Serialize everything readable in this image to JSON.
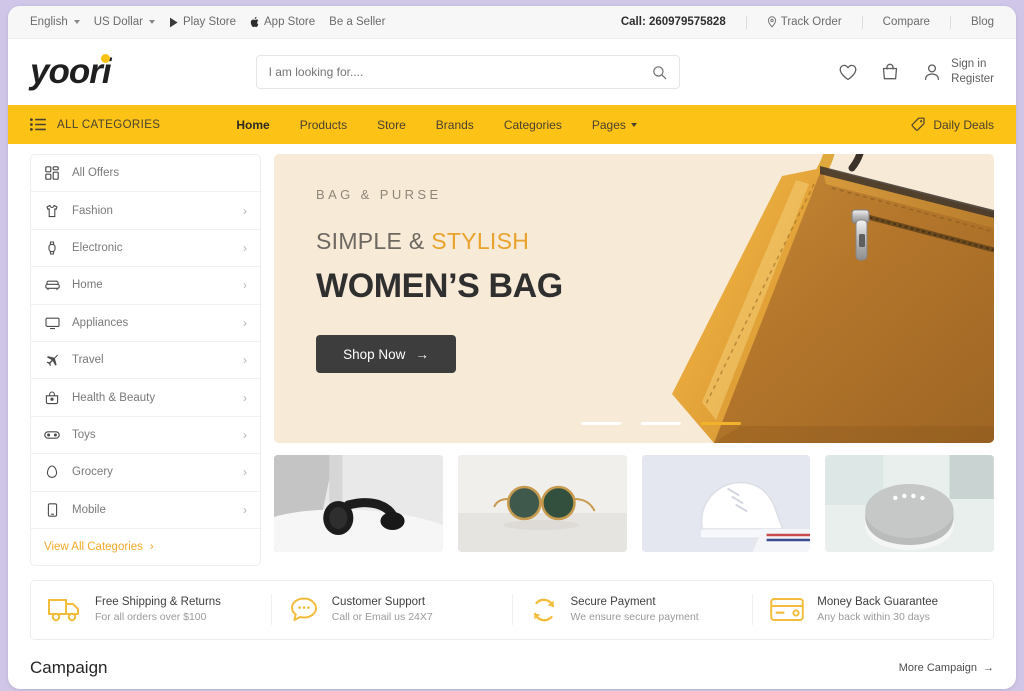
{
  "topbar": {
    "language": "English",
    "currency": "US Dollar",
    "play_store": "Play Store",
    "app_store": "App Store",
    "be_a_seller": "Be a Seller",
    "call": "Call: 260979575828",
    "track_order": "Track Order",
    "compare": "Compare",
    "blog": "Blog"
  },
  "header": {
    "logo": "yoori",
    "search_placeholder": "I am looking for....",
    "search_value": "",
    "sign_in": "Sign in",
    "register": "Register"
  },
  "nav": {
    "all_categories": "ALL CATEGORIES",
    "links": [
      {
        "label": "Home",
        "active": true
      },
      {
        "label": "Products",
        "active": false
      },
      {
        "label": "Store",
        "active": false
      },
      {
        "label": "Brands",
        "active": false
      },
      {
        "label": "Categories",
        "active": false
      },
      {
        "label": "Pages",
        "active": false,
        "has_dropdown": true
      }
    ],
    "daily_deals": "Daily Deals"
  },
  "sidebar": {
    "items": [
      {
        "label": "All Offers",
        "icon": "grid-icon",
        "chevron": false
      },
      {
        "label": "Fashion",
        "icon": "tshirt-icon",
        "chevron": true
      },
      {
        "label": "Electronic",
        "icon": "watch-icon",
        "chevron": true
      },
      {
        "label": "Home",
        "icon": "sofa-icon",
        "chevron": true
      },
      {
        "label": "Appliances",
        "icon": "monitor-icon",
        "chevron": true
      },
      {
        "label": "Travel",
        "icon": "plane-icon",
        "chevron": true
      },
      {
        "label": "Health & Beauty",
        "icon": "bag-beauty-icon",
        "chevron": true
      },
      {
        "label": "Toys",
        "icon": "mask-icon",
        "chevron": true
      },
      {
        "label": "Grocery",
        "icon": "egg-icon",
        "chevron": true
      },
      {
        "label": "Mobile",
        "icon": "phone-icon",
        "chevron": true
      }
    ],
    "view_all": "View All Categories"
  },
  "hero": {
    "kicker": "BAG & PURSE",
    "subtitle_plain": "SIMPLE & ",
    "subtitle_highlight": "STYLISH",
    "title": "WOMEN’S BAG",
    "cta": "Shop Now",
    "slides": 3,
    "active_slide": 3
  },
  "thumbnails": [
    {
      "alt": "headphones-on-bed"
    },
    {
      "alt": "round-sunglasses"
    },
    {
      "alt": "white-sneaker"
    },
    {
      "alt": "smart-speaker"
    }
  ],
  "features": [
    {
      "icon": "truck-icon",
      "title": "Free Shipping & Returns",
      "subtitle": "For all orders over $100"
    },
    {
      "icon": "chat-icon",
      "title": "Customer Support",
      "subtitle": "Call or Email us 24X7"
    },
    {
      "icon": "refresh-icon",
      "title": "Secure Payment",
      "subtitle": "We ensure secure payment"
    },
    {
      "icon": "credit-card-icon",
      "title": "Money Back Guarantee",
      "subtitle": "Any back within 30 days"
    }
  ],
  "campaign": {
    "title": "Campaign",
    "more": "More Campaign"
  },
  "colors": {
    "brand_yellow": "#fdc216",
    "accent_orange": "#f0a92a",
    "hero_bg": "#f7ead6",
    "dark_button": "#3d3d3d",
    "page_border": "#cfc6e8"
  }
}
